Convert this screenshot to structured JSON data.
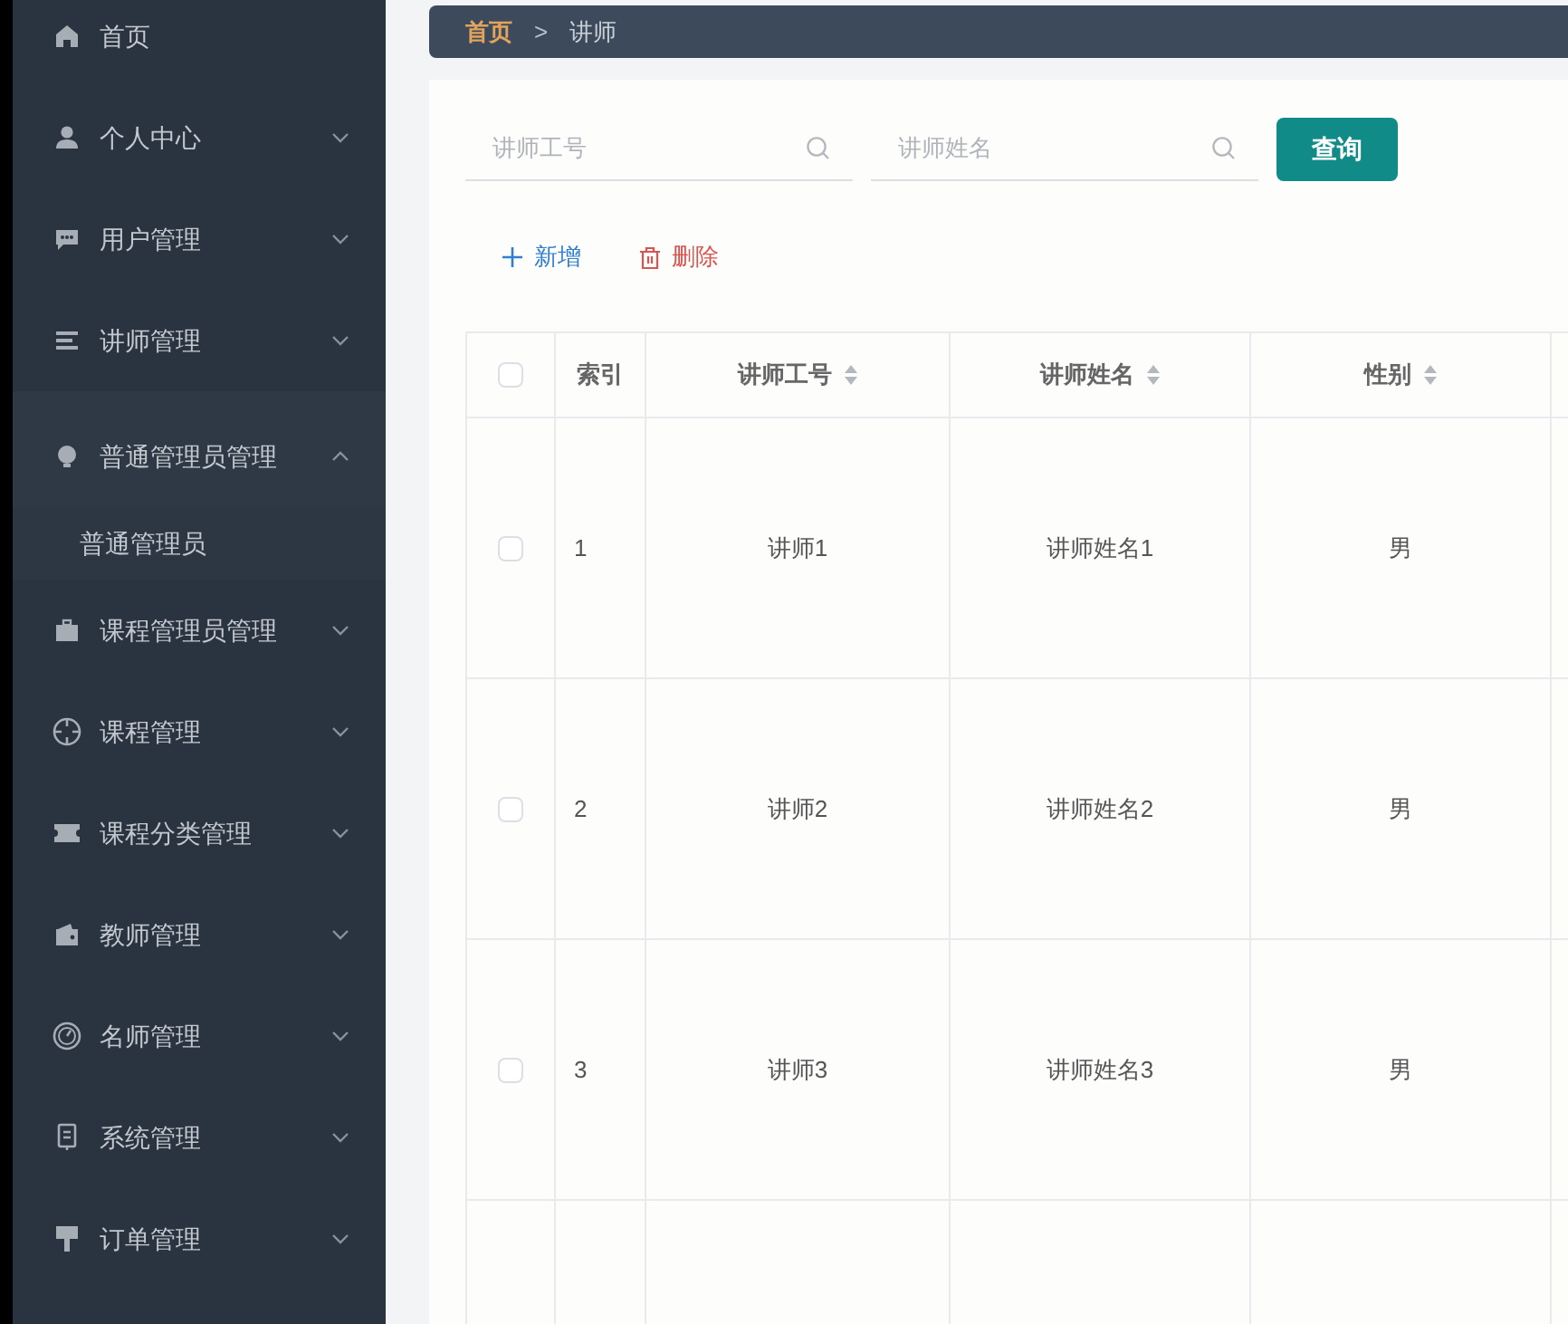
{
  "sidebar": {
    "items": [
      {
        "kind": "link",
        "label": "首页"
      },
      {
        "kind": "group",
        "label": "个人中心",
        "expanded": false
      },
      {
        "kind": "group",
        "label": "用户管理",
        "expanded": false
      },
      {
        "kind": "group",
        "label": "讲师管理",
        "expanded": false
      },
      {
        "kind": "group",
        "label": "普通管理员管理",
        "expanded": true,
        "children": [
          {
            "label": "普通管理员"
          }
        ]
      },
      {
        "kind": "group",
        "label": "课程管理员管理",
        "expanded": false
      },
      {
        "kind": "group",
        "label": "课程管理",
        "expanded": false
      },
      {
        "kind": "group",
        "label": "课程分类管理",
        "expanded": false
      },
      {
        "kind": "group",
        "label": "教师管理",
        "expanded": false
      },
      {
        "kind": "group",
        "label": "名师管理",
        "expanded": false
      },
      {
        "kind": "group",
        "label": "系统管理",
        "expanded": false
      },
      {
        "kind": "group",
        "label": "订单管理",
        "expanded": false
      }
    ]
  },
  "breadcrumb": {
    "items": [
      "首页",
      "讲师"
    ],
    "separator": ">"
  },
  "search": {
    "fields": [
      {
        "placeholder": "讲师工号"
      },
      {
        "placeholder": "讲师姓名"
      }
    ],
    "button": "查询"
  },
  "actions": [
    {
      "kind": "add",
      "label": "新增"
    },
    {
      "kind": "delete",
      "label": "删除"
    }
  ],
  "table": {
    "select_all_checked": false,
    "columns": [
      "索引",
      "讲师工号",
      "讲师姓名",
      "性别"
    ],
    "rows": [
      {
        "checked": false,
        "cells": [
          "1",
          "讲师1",
          "讲师姓名1",
          "男"
        ]
      },
      {
        "checked": false,
        "cells": [
          "2",
          "讲师2",
          "讲师姓名2",
          "男"
        ]
      },
      {
        "checked": false,
        "cells": [
          "3",
          "讲师3",
          "讲师姓名3",
          "男"
        ]
      }
    ]
  }
}
